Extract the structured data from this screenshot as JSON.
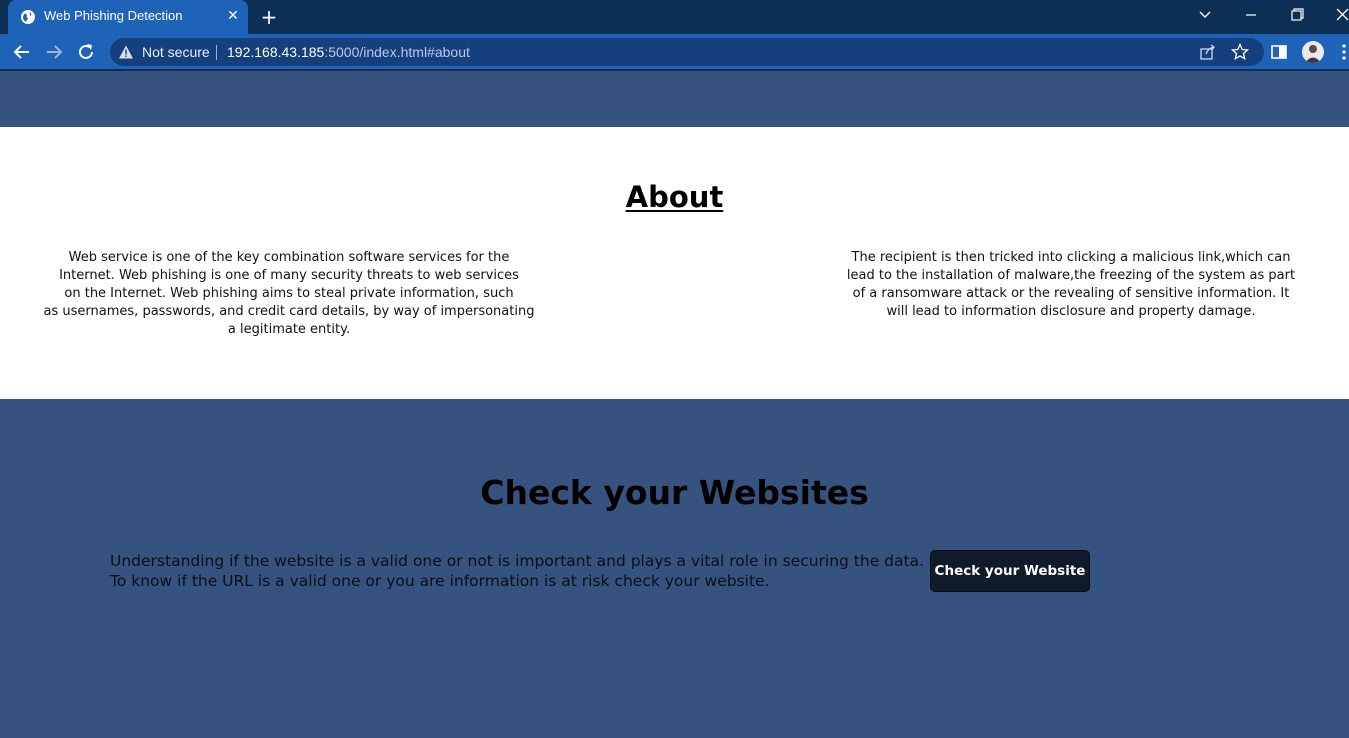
{
  "browser": {
    "tab": {
      "title": "Web Phishing Detection",
      "favicon": "globe-icon",
      "close_glyph": "✕"
    },
    "new_tab_glyph": "+",
    "omnibox": {
      "security_label": "Not secure",
      "url_host": "192.168.43.185",
      "url_rest": ":5000/index.html#about"
    },
    "colors": {
      "tab_strip": "#0d2f55",
      "active_tab": "#1f63b8",
      "toolbar": "#1f63b8"
    }
  },
  "page": {
    "about": {
      "title": "About",
      "left_lines": [
        "Web service is one of the key combination software services for the",
        "Internet. Web phishing is one of many security threats to web services",
        "on the Internet. Web phishing aims to steal private information, such",
        "as usernames, passwords, and credit card details, by way of impersonating",
        "a legitimate entity."
      ],
      "right_lines": [
        "The recipient is then tricked into clicking a malicious link,which can",
        "lead to the installation of malware,the freezing of the system as part",
        "of a ransomware attack or the revealing of sensitive information. It",
        "will lead to information disclosure and property damage."
      ]
    },
    "check": {
      "title": "Check your Websites",
      "lines": [
        "Understanding if the website is a valid one or not is important and plays a vital role in securing the data.",
        "To know if the URL is a valid one or you are information is at risk check your website."
      ],
      "button_label": "Check your Website"
    },
    "colors": {
      "band": "#36527f",
      "about_bg": "#ffffff",
      "button": "#0f1a2b"
    }
  }
}
